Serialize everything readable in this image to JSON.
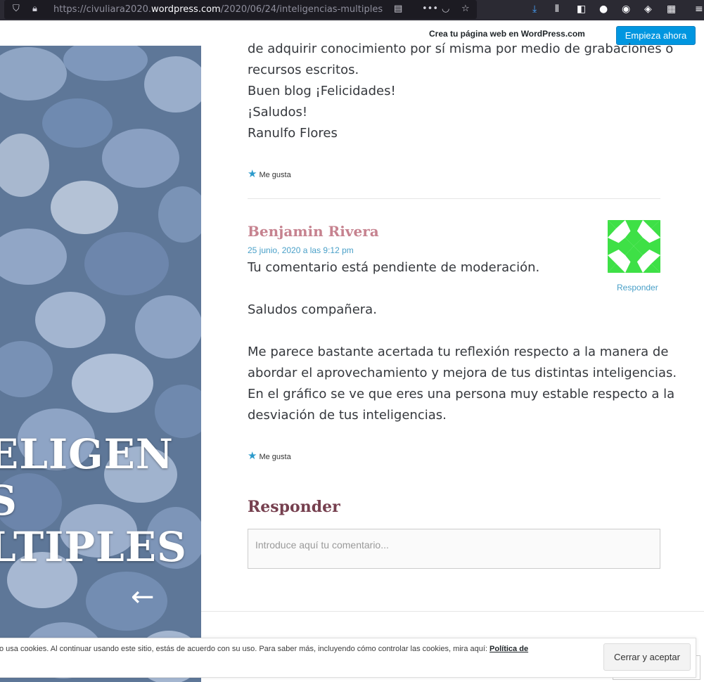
{
  "browser": {
    "url_prefix": "https://civuliara2020.",
    "url_host": "wordpress.com",
    "url_path": "/2020/06/24/inteligencias-multiples"
  },
  "wp_banner": {
    "text": "Crea tu página web en WordPress.com",
    "button": "Empieza ahora"
  },
  "hero": {
    "title_lines": [
      "ELIGEN",
      "S",
      "LTIPLES"
    ],
    "arrow": "←"
  },
  "prev_comment": {
    "lines": [
      "de adquirir conocimiento por sí misma por medio de grabaciones o",
      "recursos escritos.",
      "Buen blog ¡Felicidades!",
      "¡Saludos!",
      "Ranulfo Flores"
    ],
    "like": "Me gusta"
  },
  "comment": {
    "author": "Benjamin Rivera",
    "date": "25 junio, 2020 a las 9:12 pm",
    "pending": "Tu comentario está pendiente de moderación.",
    "greeting": "Saludos compañera.",
    "body_lines": [
      "Me parece bastante acertada tu reflexión respecto a la manera de",
      "abordar el aprovechamiento y mejora de tus distintas inteligencias.",
      "En el gráfico se ve que eres una persona muy estable respecto a la",
      "desviación de tus inteligencias."
    ],
    "reply": "Responder",
    "like": "Me gusta",
    "avatar_color": "#3ee046"
  },
  "respond": {
    "title": "Responder",
    "placeholder": "Introduce aquí tu comentario..."
  },
  "cookie": {
    "text": "o usa cookies. Al continuar usando este sitio, estás de acuerdo con su uso. Para saber más, incluyendo cómo controlar las cookies, mira aquí: ",
    "link": "Política de",
    "button": "Cerrar y aceptar"
  }
}
